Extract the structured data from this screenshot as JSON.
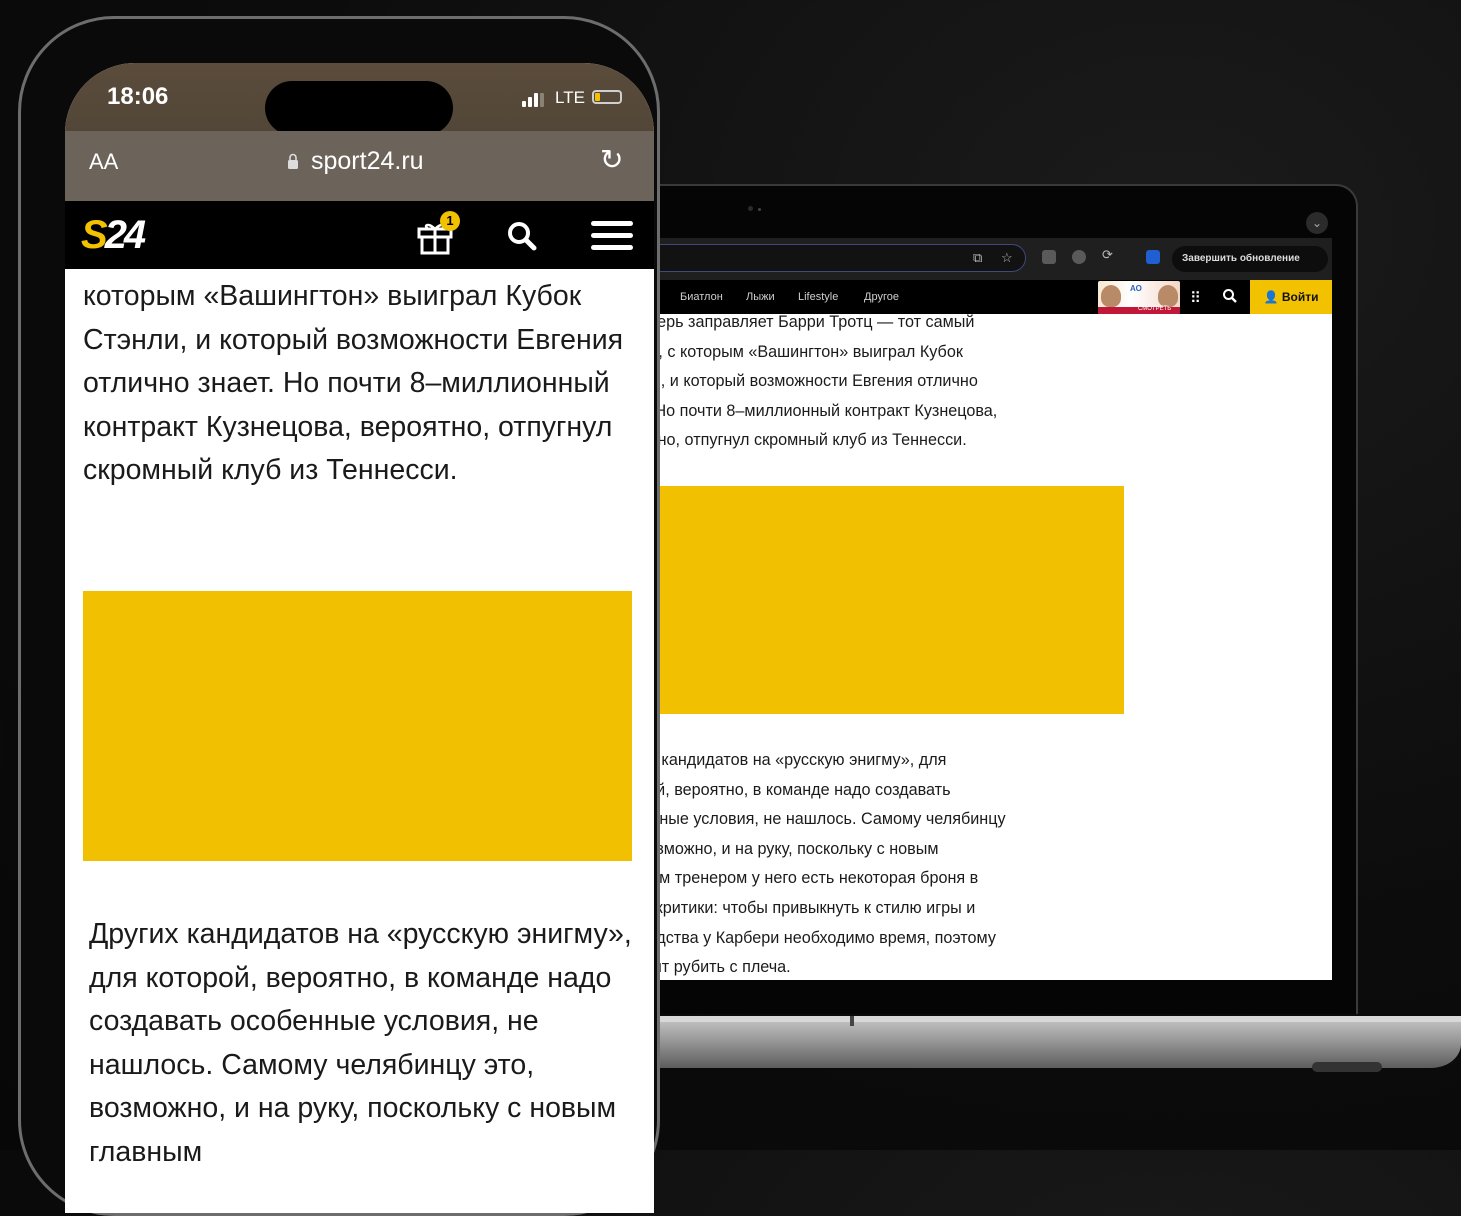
{
  "phone": {
    "status": {
      "time": "18:06",
      "network": "LTE"
    },
    "browser": {
      "text_size": "AA",
      "url": "sport24.ru"
    },
    "site": {
      "logo": "S24",
      "gift_badge": "1"
    },
    "article": {
      "paragraph_1": "которым «Вашингтон» выиграл Кубок Стэнли, и который возможности Евгения отлично знает. Но почти 8–миллионный контракт Кузнецова, вероятно, отпугнул скромный клуб из Теннесси.",
      "paragraph_2": "Других кандидатов на «русскую энигму», для которой, вероятно, в команде надо создавать особенные условия, не нашлось. Самому челябинцу это, возможно, и на руку, поскольку с новым главным"
    }
  },
  "laptop": {
    "browser": {
      "update_button": "Завершить обновление"
    },
    "nav": {
      "items": [
        "Биатлон",
        "Лыжи",
        "Lifestyle",
        "Другое"
      ],
      "login": "Войти",
      "promo_label": "АО",
      "promo_strip": "СМОТРЕТЬ"
    },
    "article": {
      "lines_1": [
        "где теперь заправляет Барри Тротц — тот самый",
        "тренер, с которым «Вашингтон» выиграл Кубок",
        "Стэнли, и который возможности Евгения отлично",
        "знает. Но почти 8–миллионный контракт Кузнецова,",
        "вероятно, отпугнул скромный клуб из Теннесси."
      ],
      "lines_2": [
        "Других кандидатов на «русскую энигму», для",
        "которой, вероятно, в команде надо создавать",
        "особенные условия, не нашлось. Самому челябинцу",
        "это, возможно, и на руку, поскольку с новым",
        "главным тренером у него есть некоторая броня в",
        "плане критики: чтобы привыкнуть к стилю игры и",
        "руководства у Карбери необходимо время, поэтому",
        "не стоит рубить с плеча."
      ]
    }
  },
  "colors": {
    "accent": "#f1c000",
    "header": "#000000"
  }
}
